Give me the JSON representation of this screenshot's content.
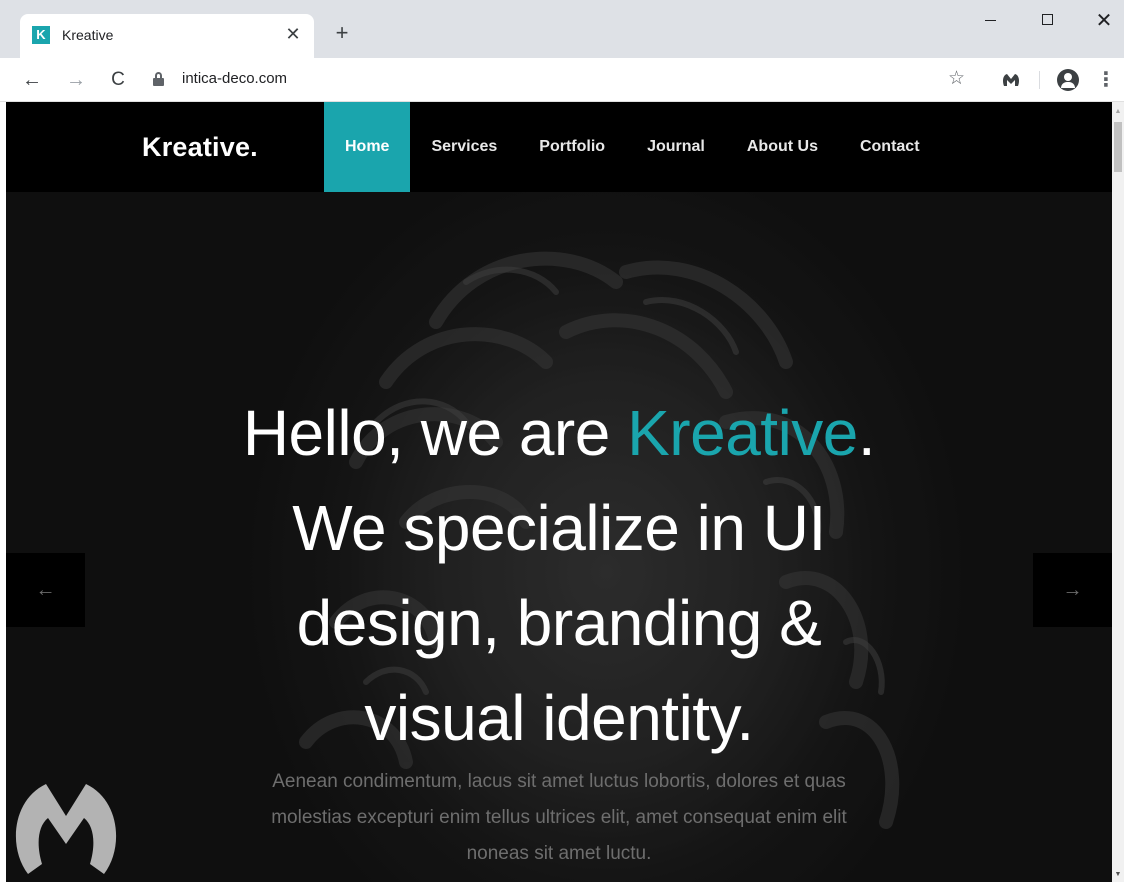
{
  "browser": {
    "tab_title": "Kreative",
    "favicon_letter": "K",
    "close_tab_glyph": "✕",
    "new_tab_glyph": "+",
    "url": "intica-deco.com",
    "back_glyph": "←",
    "forward_glyph": "→",
    "reload_glyph": "C",
    "star_glyph": "☆",
    "menu_glyph": "⋮",
    "close_window_glyph": "✕"
  },
  "site": {
    "logo": "Kreative.",
    "nav": [
      {
        "label": "Home",
        "active": true
      },
      {
        "label": "Services",
        "active": false
      },
      {
        "label": "Portfolio",
        "active": false
      },
      {
        "label": "Journal",
        "active": false
      },
      {
        "label": "About Us",
        "active": false
      },
      {
        "label": "Contact",
        "active": false
      }
    ]
  },
  "hero": {
    "line1_pre": "Hello, we are ",
    "line1_accent": "Kreative",
    "line1_post": ".",
    "line2": "We specialize in UI",
    "line3": "design, branding &",
    "line4": "visual identity.",
    "description": "Aenean condimentum, lacus sit amet luctus lobortis, dolores et quas molestias excepturi enim tellus ultrices elit, amet consequat enim elit noneas sit amet luctu.",
    "prev_glyph": "←",
    "next_glyph": "→"
  },
  "colors": {
    "accent": "#1aa5ad",
    "header_bg": "#000000",
    "hero_text": "#ffffff",
    "description_text": "#6e6e6e"
  },
  "icons": [
    "kreative-favicon",
    "close-icon",
    "plus-icon",
    "back-arrow-icon",
    "forward-arrow-icon",
    "reload-icon",
    "lock-icon",
    "star-icon",
    "malwarebytes-icon",
    "profile-icon",
    "kebab-menu-icon",
    "arrow-left-icon",
    "arrow-right-icon",
    "malwarebytes-logo"
  ]
}
